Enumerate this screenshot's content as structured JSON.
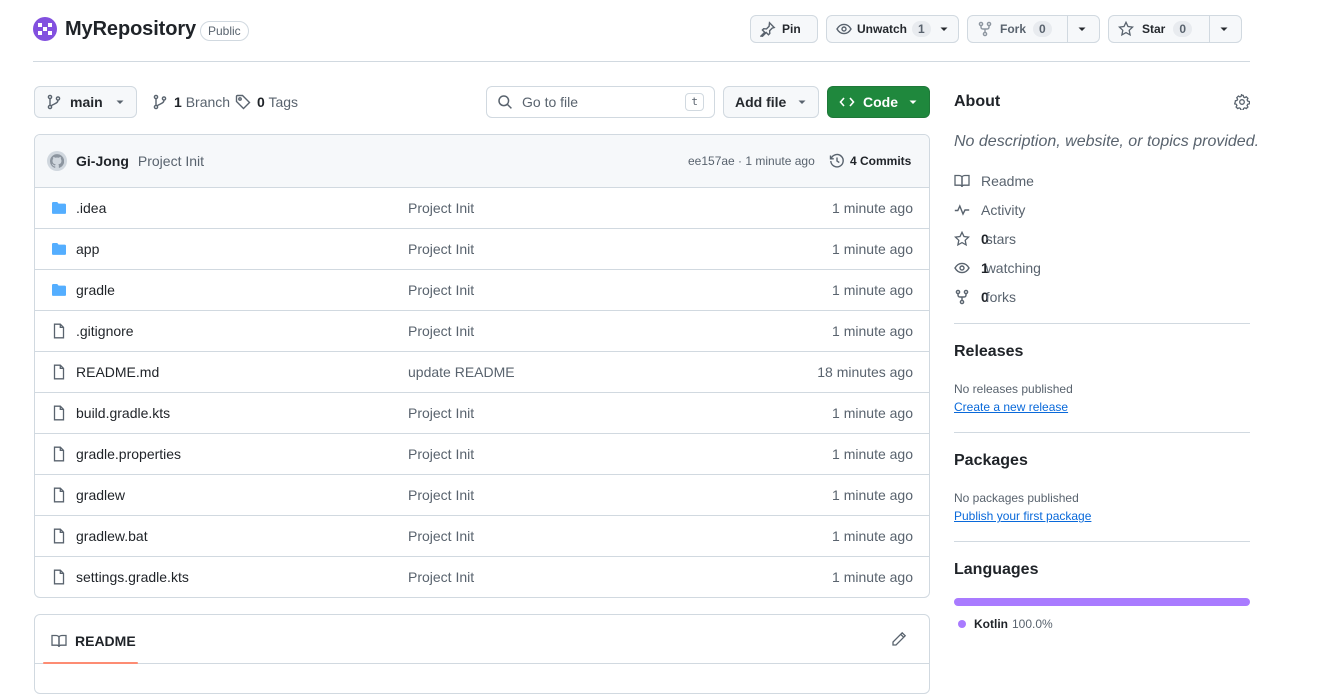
{
  "repo": {
    "name": "MyRepository",
    "visibility": "Public",
    "avatar_icon": "identicon-icon",
    "avatar_color": "#8250df"
  },
  "header_actions": {
    "pin": {
      "label": "Pin",
      "icon": "pin-icon"
    },
    "unwatch": {
      "label": "Unwatch",
      "count": "1",
      "icon": "eye-icon"
    },
    "fork": {
      "label": "Fork",
      "count": "0",
      "icon": "fork-icon"
    },
    "star": {
      "label": "Star",
      "count": "0",
      "icon": "star-icon"
    }
  },
  "toolbar": {
    "branch": "main",
    "branch_count": "1",
    "branch_label": "Branch",
    "tag_count": "0",
    "tag_label": "Tags",
    "go_to_file_placeholder": "Go to file",
    "go_to_file_shortcut": "t",
    "add_file_label": "Add file",
    "code_label": "Code",
    "code_color": "#1f883d"
  },
  "latest_commit": {
    "author": "Gi-Jong",
    "message": "Project Init",
    "meta": "ee157ae · 1 minute ago",
    "commits_label": "4 Commits"
  },
  "files": [
    {
      "name": ".idea",
      "type": "folder",
      "message": "Project Init",
      "age": "1 minute ago"
    },
    {
      "name": "app",
      "type": "folder",
      "message": "Project Init",
      "age": "1 minute ago"
    },
    {
      "name": "gradle",
      "type": "folder",
      "message": "Project Init",
      "age": "1 minute ago"
    },
    {
      "name": ".gitignore",
      "type": "file",
      "message": "Project Init",
      "age": "1 minute ago"
    },
    {
      "name": "README.md",
      "type": "file",
      "message": "update README",
      "age": "18 minutes ago"
    },
    {
      "name": "build.gradle.kts",
      "type": "file",
      "message": "Project Init",
      "age": "1 minute ago"
    },
    {
      "name": "gradle.properties",
      "type": "file",
      "message": "Project Init",
      "age": "1 minute ago"
    },
    {
      "name": "gradlew",
      "type": "file",
      "message": "Project Init",
      "age": "1 minute ago"
    },
    {
      "name": "gradlew.bat",
      "type": "file",
      "message": "Project Init",
      "age": "1 minute ago"
    },
    {
      "name": "settings.gradle.kts",
      "type": "file",
      "message": "Project Init",
      "age": "1 minute ago"
    }
  ],
  "readme": {
    "tab_label": "README"
  },
  "about": {
    "title": "About",
    "description": "No description, website, or topics provided.",
    "readme_label": "Readme",
    "activity_label": "Activity",
    "stars_count": "0",
    "stars_label": "stars",
    "watching_count": "1",
    "watching_label": "watching",
    "forks_count": "0",
    "forks_label": "forks"
  },
  "releases": {
    "title": "Releases",
    "empty_text": "No releases published",
    "create_link": "Create a new release"
  },
  "packages": {
    "title": "Packages",
    "empty_text": "No packages published",
    "publish_link": "Publish your first package"
  },
  "languages": {
    "title": "Languages",
    "items": [
      {
        "name": "Kotlin",
        "percent": "100.0%",
        "share": 1.0,
        "color": "#a97bff"
      }
    ]
  }
}
